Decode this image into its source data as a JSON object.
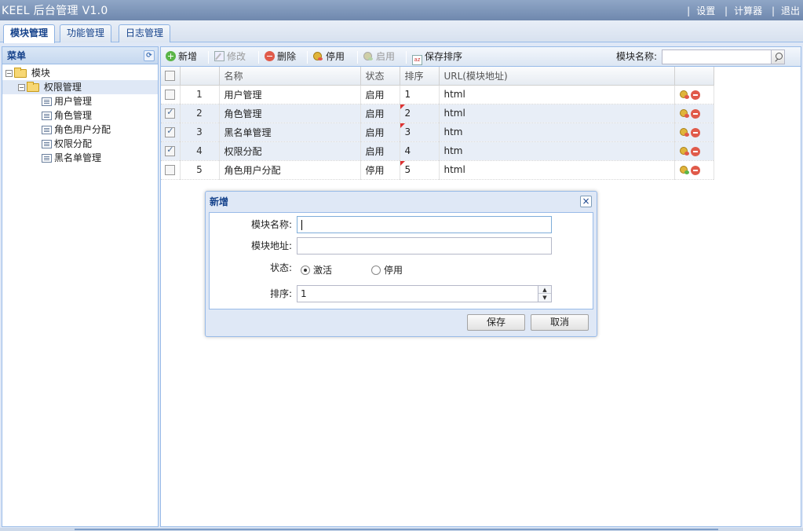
{
  "app": {
    "title": "KEEL 后台管理 V1.0",
    "links": [
      "设置",
      "计算器",
      "退出"
    ]
  },
  "tabs": [
    {
      "label": "模块管理",
      "active": true
    },
    {
      "label": "功能管理",
      "active": false
    },
    {
      "label": "日志管理",
      "active": false
    }
  ],
  "sidebar": {
    "title": "菜单",
    "tree": [
      {
        "label": "模块",
        "level": 0,
        "type": "folder",
        "expanded": true
      },
      {
        "label": "权限管理",
        "level": 1,
        "type": "folder",
        "expanded": true,
        "selected": true
      },
      {
        "label": "用户管理",
        "level": 2,
        "type": "leaf"
      },
      {
        "label": "角色管理",
        "level": 2,
        "type": "leaf"
      },
      {
        "label": "角色用户分配",
        "level": 2,
        "type": "leaf"
      },
      {
        "label": "权限分配",
        "level": 2,
        "type": "leaf"
      },
      {
        "label": "黑名单管理",
        "level": 2,
        "type": "leaf"
      }
    ]
  },
  "toolbar": {
    "add": "新增",
    "edit": "修改",
    "delete": "删除",
    "disable": "停用",
    "enable": "启用",
    "save_order": "保存排序",
    "search_label": "模块名称:",
    "search_value": ""
  },
  "grid": {
    "columns": [
      "名称",
      "状态",
      "排序",
      "URL(模块地址)"
    ],
    "rows": [
      {
        "index": "1",
        "name": "用户管理",
        "status": "启用",
        "order": "1",
        "url": "html",
        "checked": false,
        "order_dirty": false,
        "action": "disable"
      },
      {
        "index": "2",
        "name": "角色管理",
        "status": "启用",
        "order": "2",
        "url": "html",
        "checked": true,
        "order_dirty": true,
        "action": "disable"
      },
      {
        "index": "3",
        "name": "黑名单管理",
        "status": "启用",
        "order": "3",
        "url": "htm",
        "checked": true,
        "order_dirty": true,
        "action": "disable"
      },
      {
        "index": "4",
        "name": "权限分配",
        "status": "启用",
        "order": "4",
        "url": "htm",
        "checked": true,
        "order_dirty": false,
        "action": "disable"
      },
      {
        "index": "5",
        "name": "角色用户分配",
        "status": "停用",
        "order": "5",
        "url": "html",
        "checked": false,
        "order_dirty": true,
        "action": "enable"
      }
    ]
  },
  "dialog": {
    "title": "新增",
    "name_label": "模块名称:",
    "name_value": "",
    "url_label": "模块地址:",
    "url_value": "",
    "status_label": "状态:",
    "status_options": [
      "激活",
      "停用"
    ],
    "status_selected": "激活",
    "order_label": "排序:",
    "order_value": "1",
    "save": "保存",
    "cancel": "取消",
    "close_icon": "close-icon"
  },
  "colors": {
    "header": "#7d95b9",
    "panel_border": "#99bbe8",
    "title_text": "#15428b",
    "checked_row": "#e8eef7"
  }
}
